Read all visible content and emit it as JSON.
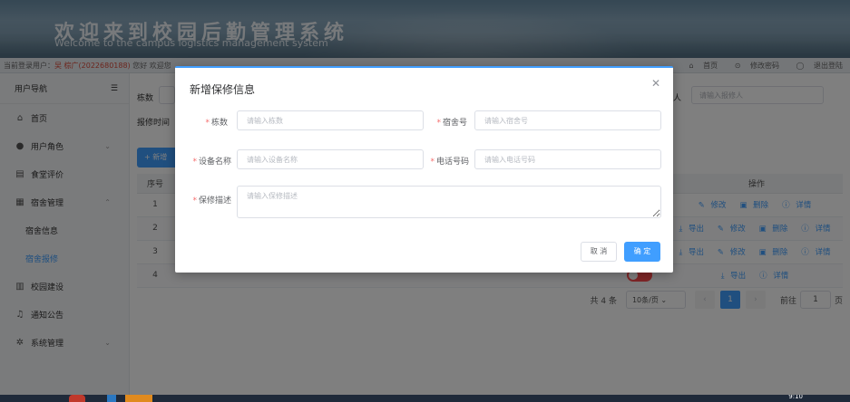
{
  "banner": {
    "title": "欢迎来到校园后勤管理系统",
    "subtitle": "Welcome to the campus logistics management system"
  },
  "infobar": {
    "login_prefix": "当前登录用户：",
    "user": "吴 棕广(2022680188)",
    "role": "您好 欢迎您",
    "home": "首页",
    "change_password": "修改密码",
    "logout": "退出登陆"
  },
  "sidebar": {
    "header": "用户导航",
    "items": [
      {
        "label": "首页",
        "icon": "home-icon"
      },
      {
        "label": "用户角色",
        "icon": "user-icon"
      },
      {
        "label": "食堂评价",
        "icon": "document-icon"
      },
      {
        "label": "宿舍管理",
        "icon": "building-icon"
      },
      {
        "label": "宿舍信息"
      },
      {
        "label": "宿舍报修"
      },
      {
        "label": "校园建设",
        "icon": "chart-icon"
      },
      {
        "label": "通知公告",
        "icon": "bell-icon"
      },
      {
        "label": "系统管理",
        "icon": "gear-icon"
      }
    ]
  },
  "filters": {
    "building_label": "栋数",
    "repair_time_label": "报修时间",
    "reporter_label": "人",
    "reporter_placeholder": "请输入报修人"
  },
  "toolbar": {
    "add_label": "+ 新增"
  },
  "table": {
    "headers": [
      "序号",
      "操作"
    ],
    "rows": [
      {
        "index": "1",
        "ops": [
          "修改",
          "删除",
          "详情"
        ]
      },
      {
        "index": "2",
        "ops": [
          "导出",
          "修改",
          "删除",
          "详情"
        ]
      },
      {
        "index": "3",
        "ops": [
          "导出",
          "修改",
          "删除",
          "详情"
        ]
      },
      {
        "index": "4",
        "ops": [
          "导出",
          "详情"
        ]
      }
    ]
  },
  "pager": {
    "total": "共 4 条",
    "page_size": "10条/页",
    "current": "1",
    "goto_label": "前往",
    "goto_value": "1",
    "page_unit": "页"
  },
  "dialog": {
    "title": "新增保修信息",
    "fields": {
      "building": {
        "label": "栋数",
        "placeholder": "请输入栋数"
      },
      "dorm": {
        "label": "宿舍号",
        "placeholder": "请输入宿舍号"
      },
      "device": {
        "label": "设备名称",
        "placeholder": "请输入设备名称"
      },
      "phone": {
        "label": "电话号码",
        "placeholder": "请输入电话号码"
      },
      "desc": {
        "label": "保修描述",
        "placeholder": "请输入保修描述"
      }
    },
    "cancel_label": "取 消",
    "ok_label": "确 定"
  },
  "taskbar": {
    "clock": "9:10"
  },
  "colors": {
    "primary": "#409eff",
    "required": "#f56c6c",
    "danger": "#ff4d4f"
  }
}
